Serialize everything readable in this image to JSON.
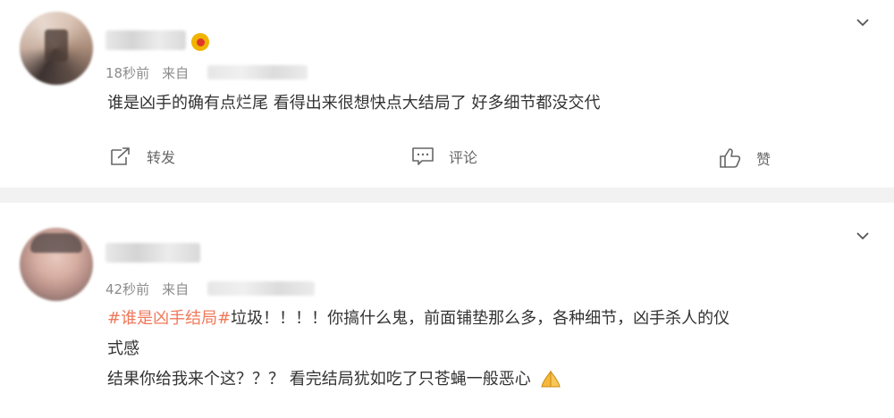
{
  "post1": {
    "time": "18秒前",
    "from_label": "来自",
    "content": "谁是凶手的确有点烂尾 看得出来很想快点大结局了 好多细节都没交代",
    "actions": {
      "repost": "转发",
      "comment": "评论",
      "like": "赞"
    }
  },
  "post2": {
    "time": "42秒前",
    "from_label": "来自",
    "hashtag": "#谁是凶手结局#",
    "line1_rest": "垃圾！！！！你搞什么鬼，前面铺垫那么多，各种细节，凶手杀人的仪",
    "line2": "式感",
    "line3": "结果你给我来个这？？？ 看完结局犹如吃了只苍蝇一般恶心"
  },
  "icons": [
    "chevron-down-icon",
    "repost-icon",
    "comment-icon",
    "like-icon",
    "vip-badge-icon",
    "pray-hands-icon"
  ],
  "colors": {
    "hashtag": "#f0785a",
    "meta_gray": "#8c8c8c",
    "divider": "#f2f2f2"
  }
}
